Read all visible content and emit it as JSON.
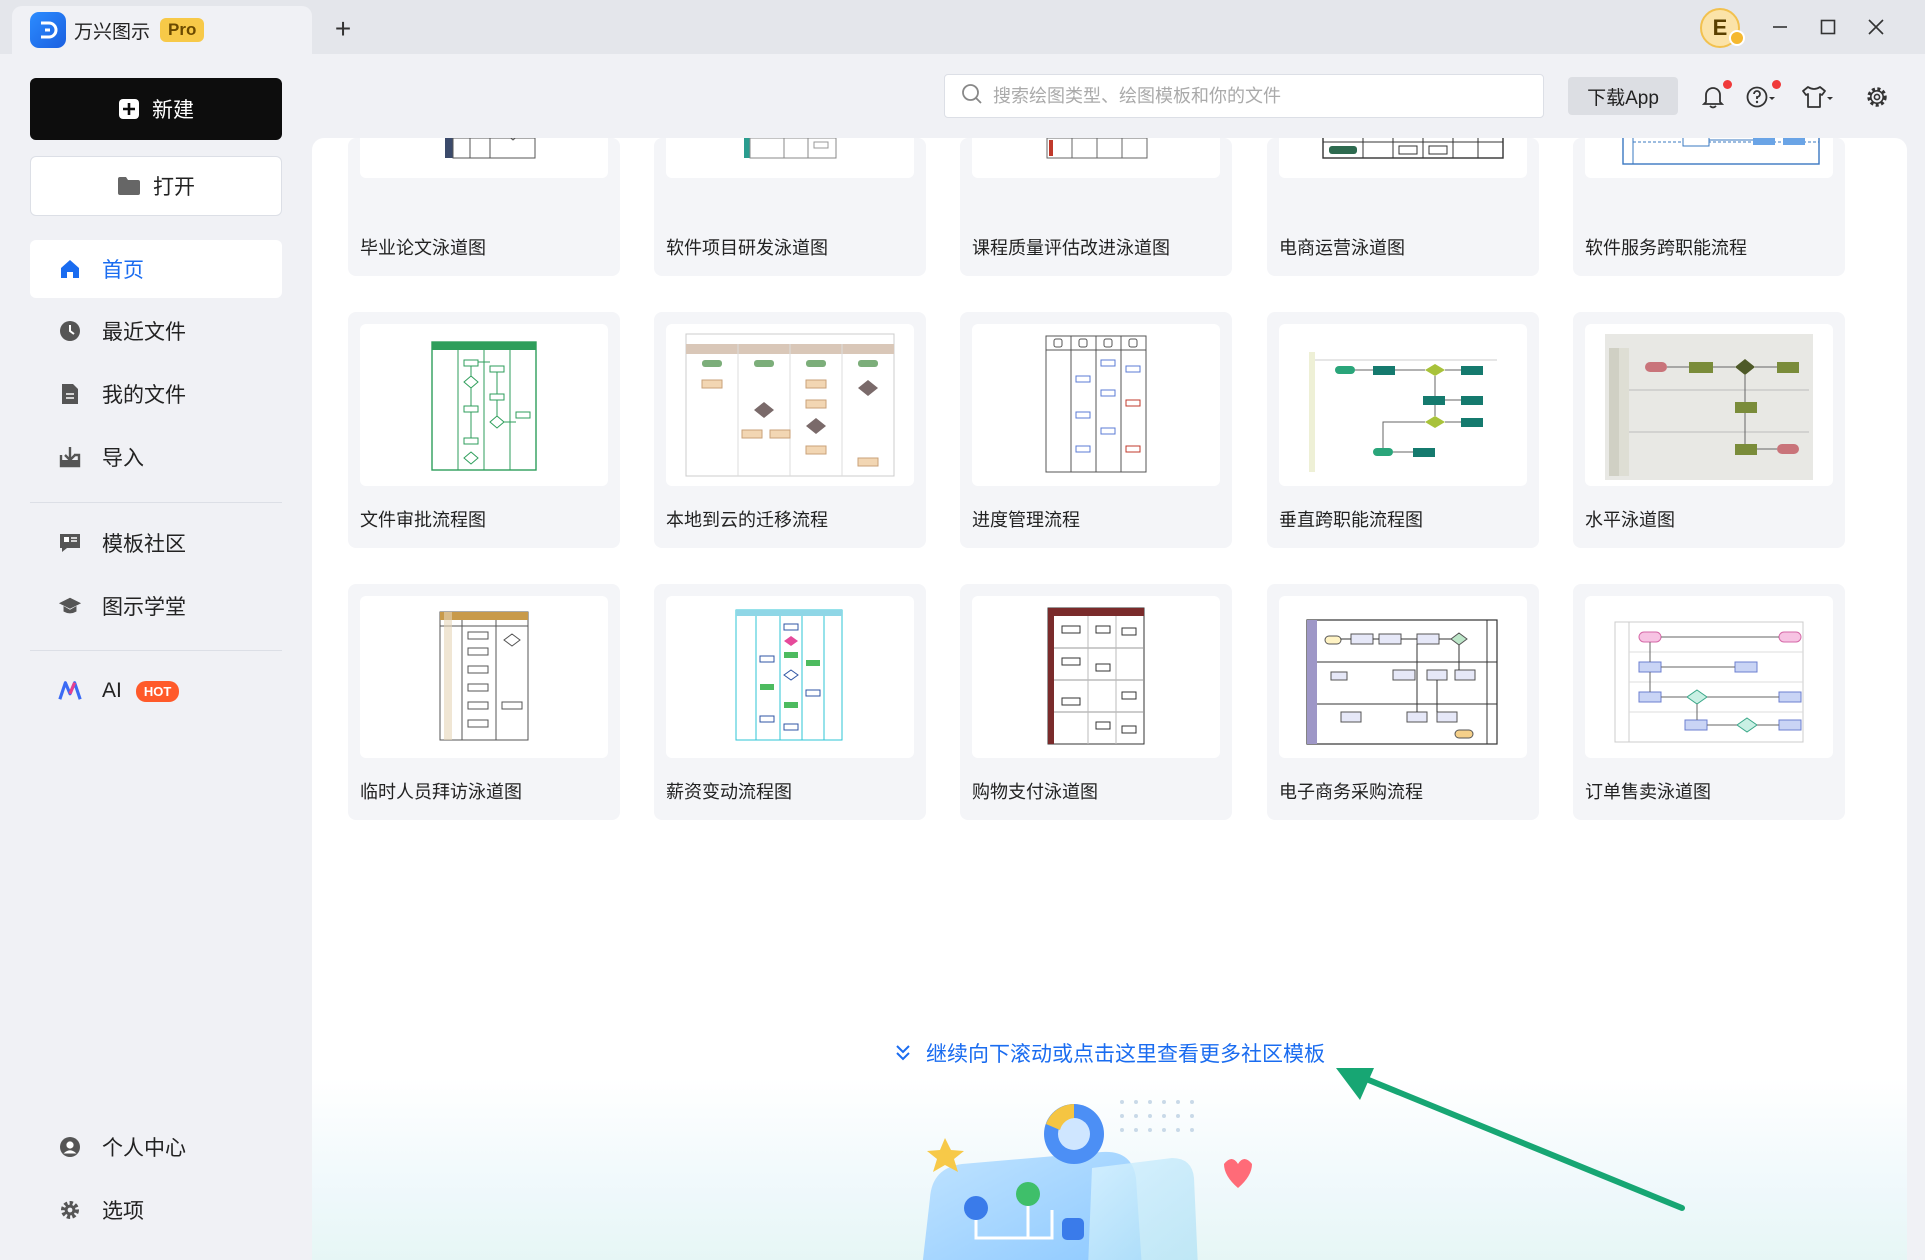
{
  "app": {
    "name": "万兴图示",
    "badge": "Pro",
    "new_tab": "+",
    "avatar_letter": "E"
  },
  "sidebar": {
    "new_label": "新建",
    "open_label": "打开",
    "nav": [
      {
        "label": "首页",
        "icon": "home-icon",
        "active": true
      },
      {
        "label": "最近文件",
        "icon": "clock-icon"
      },
      {
        "label": "我的文件",
        "icon": "file-icon"
      },
      {
        "label": "导入",
        "icon": "import-icon"
      },
      {
        "label": "模板社区",
        "icon": "community-icon"
      },
      {
        "label": "图示学堂",
        "icon": "graduation-cap-icon"
      },
      {
        "label": "AI",
        "icon": "ai-icon",
        "badge": "HOT"
      },
      {
        "label": "个人中心",
        "icon": "user-icon"
      },
      {
        "label": "选项",
        "icon": "gear-icon"
      }
    ]
  },
  "toolbar": {
    "search_placeholder": "搜索绘图类型、绘图模板和你的文件",
    "download_label": "下载App"
  },
  "templates": [
    [
      "毕业论文泳道图",
      "软件项目研发泳道图",
      "课程质量评估改进泳道图",
      "电商运营泳道图",
      "软件服务跨职能流程"
    ],
    [
      "文件审批流程图",
      "本地到云的迁移流程",
      "进度管理流程",
      "垂直跨职能流程图",
      "水平泳道图"
    ],
    [
      "临时人员拜访泳道图",
      "薪资变动流程图",
      "购物支付泳道图",
      "电子商务采购流程",
      "订单售卖泳道图"
    ]
  ],
  "more_link": "继续向下滚动或点击这里查看更多社区模板",
  "colors": {
    "accent": "#1a6cf0",
    "arrow": "#17a673",
    "hot": "#ff5a2a",
    "pro": "#f7c948"
  }
}
